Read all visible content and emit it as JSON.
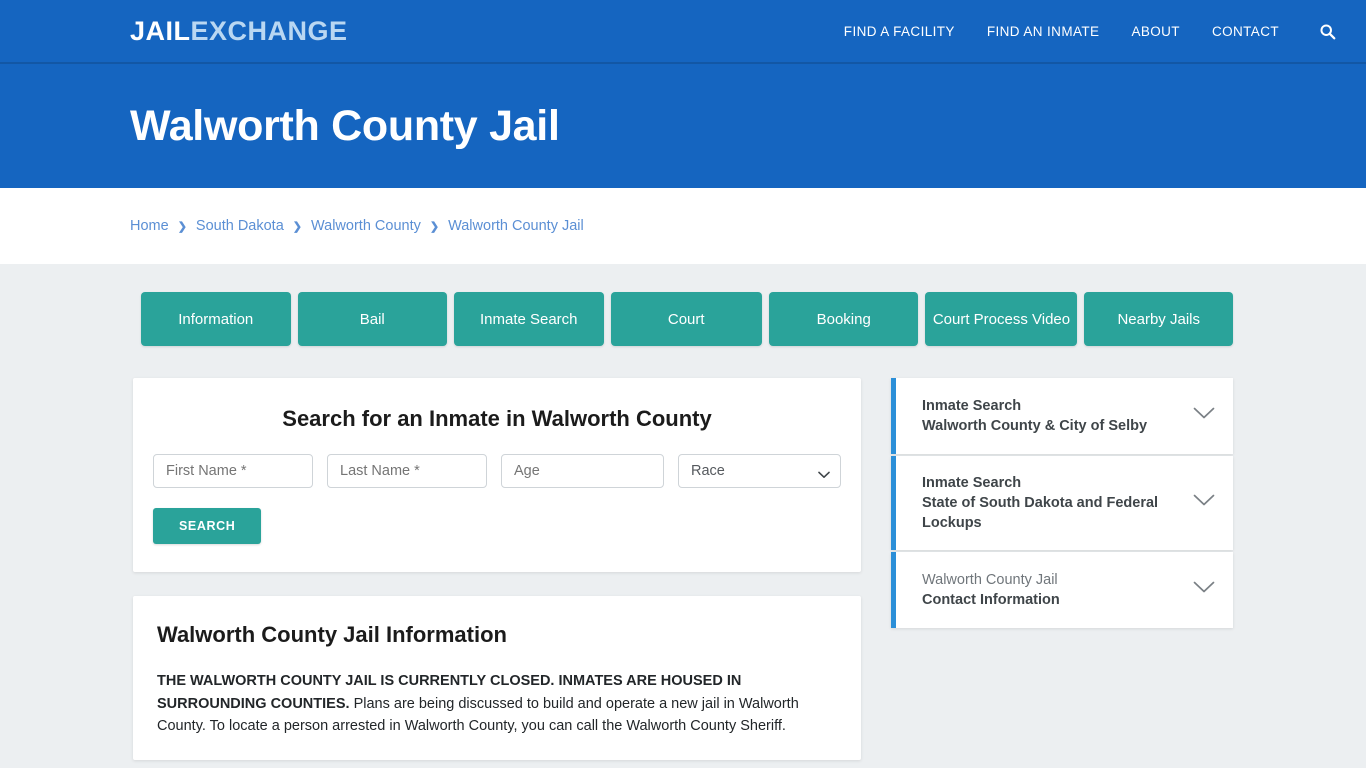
{
  "brand": {
    "logo_primary": "JAIL",
    "logo_secondary": "EXCHANGE"
  },
  "nav": {
    "items": [
      {
        "label": "FIND A FACILITY"
      },
      {
        "label": "FIND AN INMATE"
      },
      {
        "label": "ABOUT"
      },
      {
        "label": "CONTACT"
      }
    ],
    "search_icon": "search-icon"
  },
  "hero": {
    "title": "Walworth County Jail"
  },
  "breadcrumb": {
    "items": [
      {
        "label": "Home"
      },
      {
        "label": "South Dakota"
      },
      {
        "label": "Walworth County"
      },
      {
        "label": "Walworth County Jail"
      }
    ],
    "separator": "❯"
  },
  "tabs": [
    {
      "label": "Information"
    },
    {
      "label": "Bail"
    },
    {
      "label": "Inmate Search"
    },
    {
      "label": "Court"
    },
    {
      "label": "Booking"
    },
    {
      "label": "Court Process Video"
    },
    {
      "label": "Nearby Jails"
    }
  ],
  "search_panel": {
    "heading": "Search for an Inmate in Walworth County",
    "first_name": {
      "placeholder": "First Name *",
      "value": ""
    },
    "last_name": {
      "placeholder": "Last Name *",
      "value": ""
    },
    "age": {
      "placeholder": "Age",
      "value": ""
    },
    "race": {
      "selected": "Race"
    },
    "submit_label": "SEARCH"
  },
  "info_panel": {
    "heading": "Walworth County Jail Information",
    "body_bold": "THE WALWORTH COUNTY JAIL IS CURRENTLY CLOSED.  INMATES ARE HOUSED IN SURROUNDING COUNTIES.",
    "body_rest": " Plans are being discussed to build and operate a new jail in Walworth County.  To locate a person arrested in Walworth County, you can call the Walworth County Sheriff."
  },
  "sidebar": {
    "accordions": [
      {
        "line1": "Inmate Search",
        "line2": "Walworth County & City of Selby",
        "line1_style": "bold",
        "icon": "chevron-down-icon"
      },
      {
        "line1": "Inmate Search",
        "line2": "State of South Dakota and Federal Lockups",
        "line1_style": "bold",
        "icon": "chevron-down-icon"
      },
      {
        "line1": "Walworth County Jail",
        "line2": "Contact Information",
        "line1_style": "light",
        "icon": "chevron-down-icon"
      }
    ]
  },
  "colors": {
    "header_blue": "#1565c0",
    "teal": "#2aa39a",
    "accent_blue": "#2b8fd8",
    "page_bg": "#eceff1",
    "link_blue": "#5b8fd4"
  }
}
